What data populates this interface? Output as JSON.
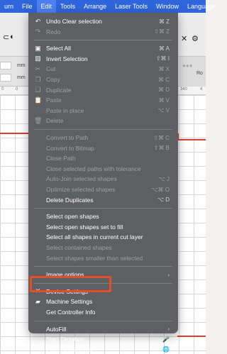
{
  "menubar": {
    "items": [
      "urn",
      "File",
      "Edit",
      "Tools",
      "Arrange",
      "Laser Tools",
      "Window",
      "Language"
    ],
    "active_index": 2
  },
  "toolbar": {
    "units": [
      "mm",
      "mm"
    ],
    "right_text": "Ro"
  },
  "ruler": {
    "labels": [
      "0",
      "0",
      "0",
      "340",
      "4"
    ]
  },
  "edit_menu": {
    "items": [
      {
        "type": "item",
        "label": "Undo Clear selection",
        "shortcut": "⌘ Z",
        "icon": "undo-icon",
        "disabled": false
      },
      {
        "type": "item",
        "label": "Redo",
        "shortcut": "⇧⌘ Z",
        "icon": "redo-icon",
        "disabled": true
      },
      {
        "type": "sep"
      },
      {
        "type": "item",
        "label": "Select All",
        "shortcut": "⌘ A",
        "icon": "select-all-icon",
        "disabled": false
      },
      {
        "type": "item",
        "label": "Invert Selection",
        "shortcut": "⇧⌘ I",
        "icon": "invert-selection-icon",
        "disabled": false
      },
      {
        "type": "item",
        "label": "Cut",
        "shortcut": "⌘ X",
        "icon": "scissors-icon",
        "disabled": true
      },
      {
        "type": "item",
        "label": "Copy",
        "shortcut": "⌘ C",
        "icon": "copy-icon",
        "disabled": true
      },
      {
        "type": "item",
        "label": "Duplicate",
        "shortcut": "⌘ D",
        "icon": "duplicate-icon",
        "disabled": true
      },
      {
        "type": "item",
        "label": "Paste",
        "shortcut": "⌘ V",
        "icon": "paste-icon",
        "disabled": true
      },
      {
        "type": "item",
        "label": "Paste in place",
        "shortcut": "⌥ V",
        "icon": "",
        "disabled": true
      },
      {
        "type": "item",
        "label": "Delete",
        "shortcut": "",
        "icon": "trash-icon",
        "disabled": true
      },
      {
        "type": "sep"
      },
      {
        "type": "item",
        "label": "Convert to Path",
        "shortcut": "⇧⌘ C",
        "icon": "",
        "disabled": true
      },
      {
        "type": "item",
        "label": "Convert to Bitmap",
        "shortcut": "⇧⌘ B",
        "icon": "",
        "disabled": true
      },
      {
        "type": "item",
        "label": "Close Path",
        "shortcut": "",
        "icon": "",
        "disabled": true
      },
      {
        "type": "item",
        "label": "Close selected paths with tolerance",
        "shortcut": "",
        "icon": "",
        "disabled": true
      },
      {
        "type": "item",
        "label": "Auto-Join selected shapes",
        "shortcut": "⌥ J",
        "icon": "",
        "disabled": true
      },
      {
        "type": "item",
        "label": "Optimize selected shapes",
        "shortcut": "⌥⌘ O",
        "icon": "",
        "disabled": true
      },
      {
        "type": "item",
        "label": "Delete Duplicates",
        "shortcut": "⌥ D",
        "icon": "",
        "disabled": false
      },
      {
        "type": "sep"
      },
      {
        "type": "item",
        "label": "Select open shapes",
        "shortcut": "",
        "icon": "",
        "disabled": false
      },
      {
        "type": "item",
        "label": "Select open shapes set to fill",
        "shortcut": "",
        "icon": "",
        "disabled": false
      },
      {
        "type": "item",
        "label": "Select all shapes in current cut layer",
        "shortcut": "",
        "icon": "",
        "disabled": false
      },
      {
        "type": "item",
        "label": "Select contained shapes",
        "shortcut": "",
        "icon": "",
        "disabled": true
      },
      {
        "type": "item",
        "label": "Select shapes smaller than selected",
        "shortcut": "",
        "icon": "",
        "disabled": true
      },
      {
        "type": "sep"
      },
      {
        "type": "item",
        "label": "Image options",
        "shortcut": "›",
        "icon": "",
        "disabled": false
      },
      {
        "type": "sep"
      },
      {
        "type": "item",
        "label": "Device Settings",
        "shortcut": "",
        "icon": "tools-icon",
        "disabled": false
      },
      {
        "type": "item",
        "label": "Machine Settings",
        "shortcut": "",
        "icon": "machine-icon",
        "disabled": false
      },
      {
        "type": "item",
        "label": "Get Controller Info",
        "shortcut": "",
        "icon": "",
        "disabled": false
      },
      {
        "type": "sep"
      },
      {
        "type": "item",
        "label": "AutoFill",
        "shortcut": "›",
        "icon": "",
        "disabled": false
      },
      {
        "type": "item",
        "label": "Start Dictation...",
        "shortcut": "🎤",
        "icon": "",
        "disabled": false
      },
      {
        "type": "item",
        "label": "Emoji & Symbols",
        "shortcut": "🌐",
        "icon": "",
        "disabled": false
      }
    ]
  },
  "colors": {
    "menubar": "#2e65dc",
    "menu_bg": "#5d5f62",
    "highlight": "#e74c2b",
    "path_red": "#e23b30"
  }
}
